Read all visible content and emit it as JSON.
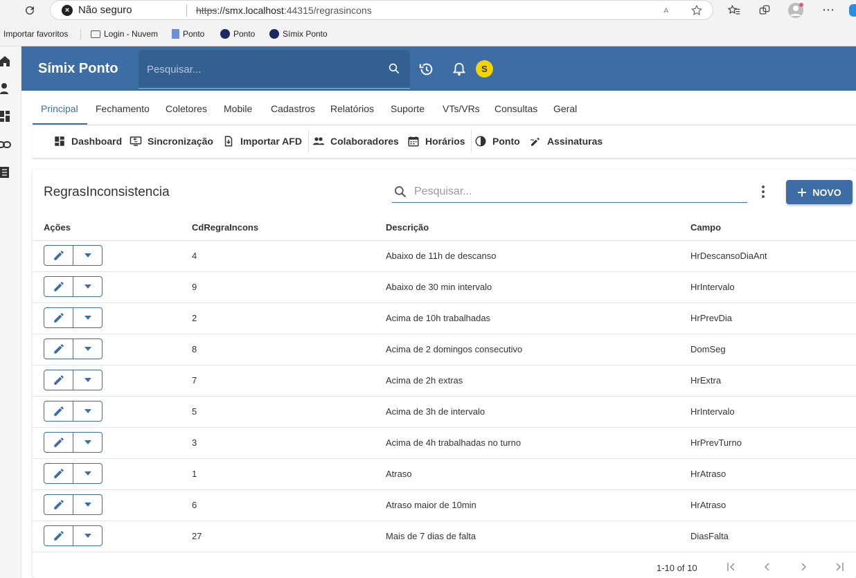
{
  "browser": {
    "security_label": "Não seguro",
    "url_scheme": "https",
    "url_host": "://smx.localhost",
    "url_rest": ":44315/regrasincons",
    "favorites": [
      {
        "label": "Importar favoritos"
      },
      {
        "label": "Login - Nuvem"
      },
      {
        "label": "Ponto"
      },
      {
        "label": "Ponto"
      },
      {
        "label": "Símix Ponto"
      }
    ]
  },
  "header": {
    "brand": "Símix Ponto",
    "search_placeholder": "Pesquisar...",
    "avatar_initial": "S",
    "accent_color": "#3c6ea5"
  },
  "tabs": [
    "Principal",
    "Fechamento",
    "Coletores",
    "Mobile",
    "Cadastros",
    "Relatórios",
    "Suporte",
    "VTs/VRs",
    "Consultas",
    "Geral"
  ],
  "subnav": [
    "Dashboard",
    "Sincronização",
    "Importar AFD",
    "Colaboradores",
    "Horários",
    "Ponto",
    "Assinaturas"
  ],
  "card": {
    "title": "RegrasInconsistencia",
    "search_placeholder": "Pesquisar...",
    "new_label": "NOVO"
  },
  "table": {
    "columns": [
      "Ações",
      "CdRegraIncons",
      "Descrição",
      "Campo"
    ],
    "rows": [
      {
        "cd": "4",
        "descricao": "Abaixo de 11h de descanso",
        "campo": "HrDescansoDiaAnt"
      },
      {
        "cd": "9",
        "descricao": "Abaixo de 30 min intervalo",
        "campo": "HrIntervalo"
      },
      {
        "cd": "2",
        "descricao": "Acima de 10h trabalhadas",
        "campo": "HrPrevDia"
      },
      {
        "cd": "8",
        "descricao": "Acima de 2 domingos consecutivo",
        "campo": "DomSeg"
      },
      {
        "cd": "7",
        "descricao": "Acima de 2h extras",
        "campo": "HrExtra"
      },
      {
        "cd": "5",
        "descricao": "Acima de 3h de intervalo",
        "campo": "HrIntervalo"
      },
      {
        "cd": "3",
        "descricao": "Acima de 4h trabalhadas no turno",
        "campo": "HrPrevTurno"
      },
      {
        "cd": "1",
        "descricao": "Atraso",
        "campo": "HrAtraso"
      },
      {
        "cd": "6",
        "descricao": "Atraso maior de 10min",
        "campo": "HrAtraso"
      },
      {
        "cd": "27",
        "descricao": "Mais de 7 dias de falta",
        "campo": "DiasFalta"
      }
    ]
  },
  "pagination": {
    "range": "1-10 of 10"
  }
}
